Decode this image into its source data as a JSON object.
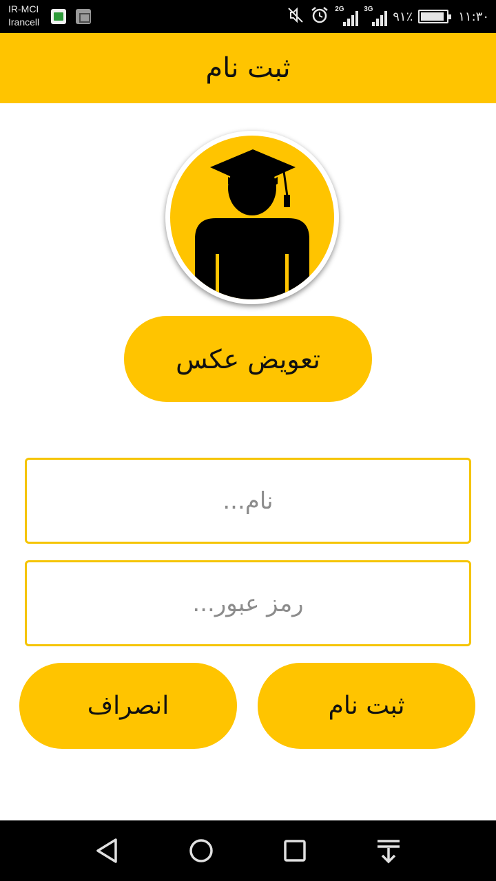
{
  "status_bar": {
    "carrier_1": "IR-MCI",
    "carrier_2": "Irancell",
    "network_1": "2G",
    "network_2": "3G",
    "battery_percent_text": "۹۱٪",
    "battery_level": 0.91,
    "time": "۱۱:۳۰"
  },
  "app_bar": {
    "title": "ثبت نام"
  },
  "avatar": {
    "icon": "graduate-icon",
    "background": "#ffc400"
  },
  "change_photo_label": "تعویض عکس",
  "form": {
    "name_placeholder": "نام...",
    "password_placeholder": "رمز عبور..."
  },
  "buttons": {
    "register_label": "ثبت نام",
    "cancel_label": "انصراف"
  },
  "colors": {
    "accent": "#ffc400",
    "field_border": "#f5c400"
  },
  "nav_bar": {
    "icons": [
      "back-icon",
      "home-icon",
      "recents-icon",
      "notifications-pull-icon"
    ]
  }
}
